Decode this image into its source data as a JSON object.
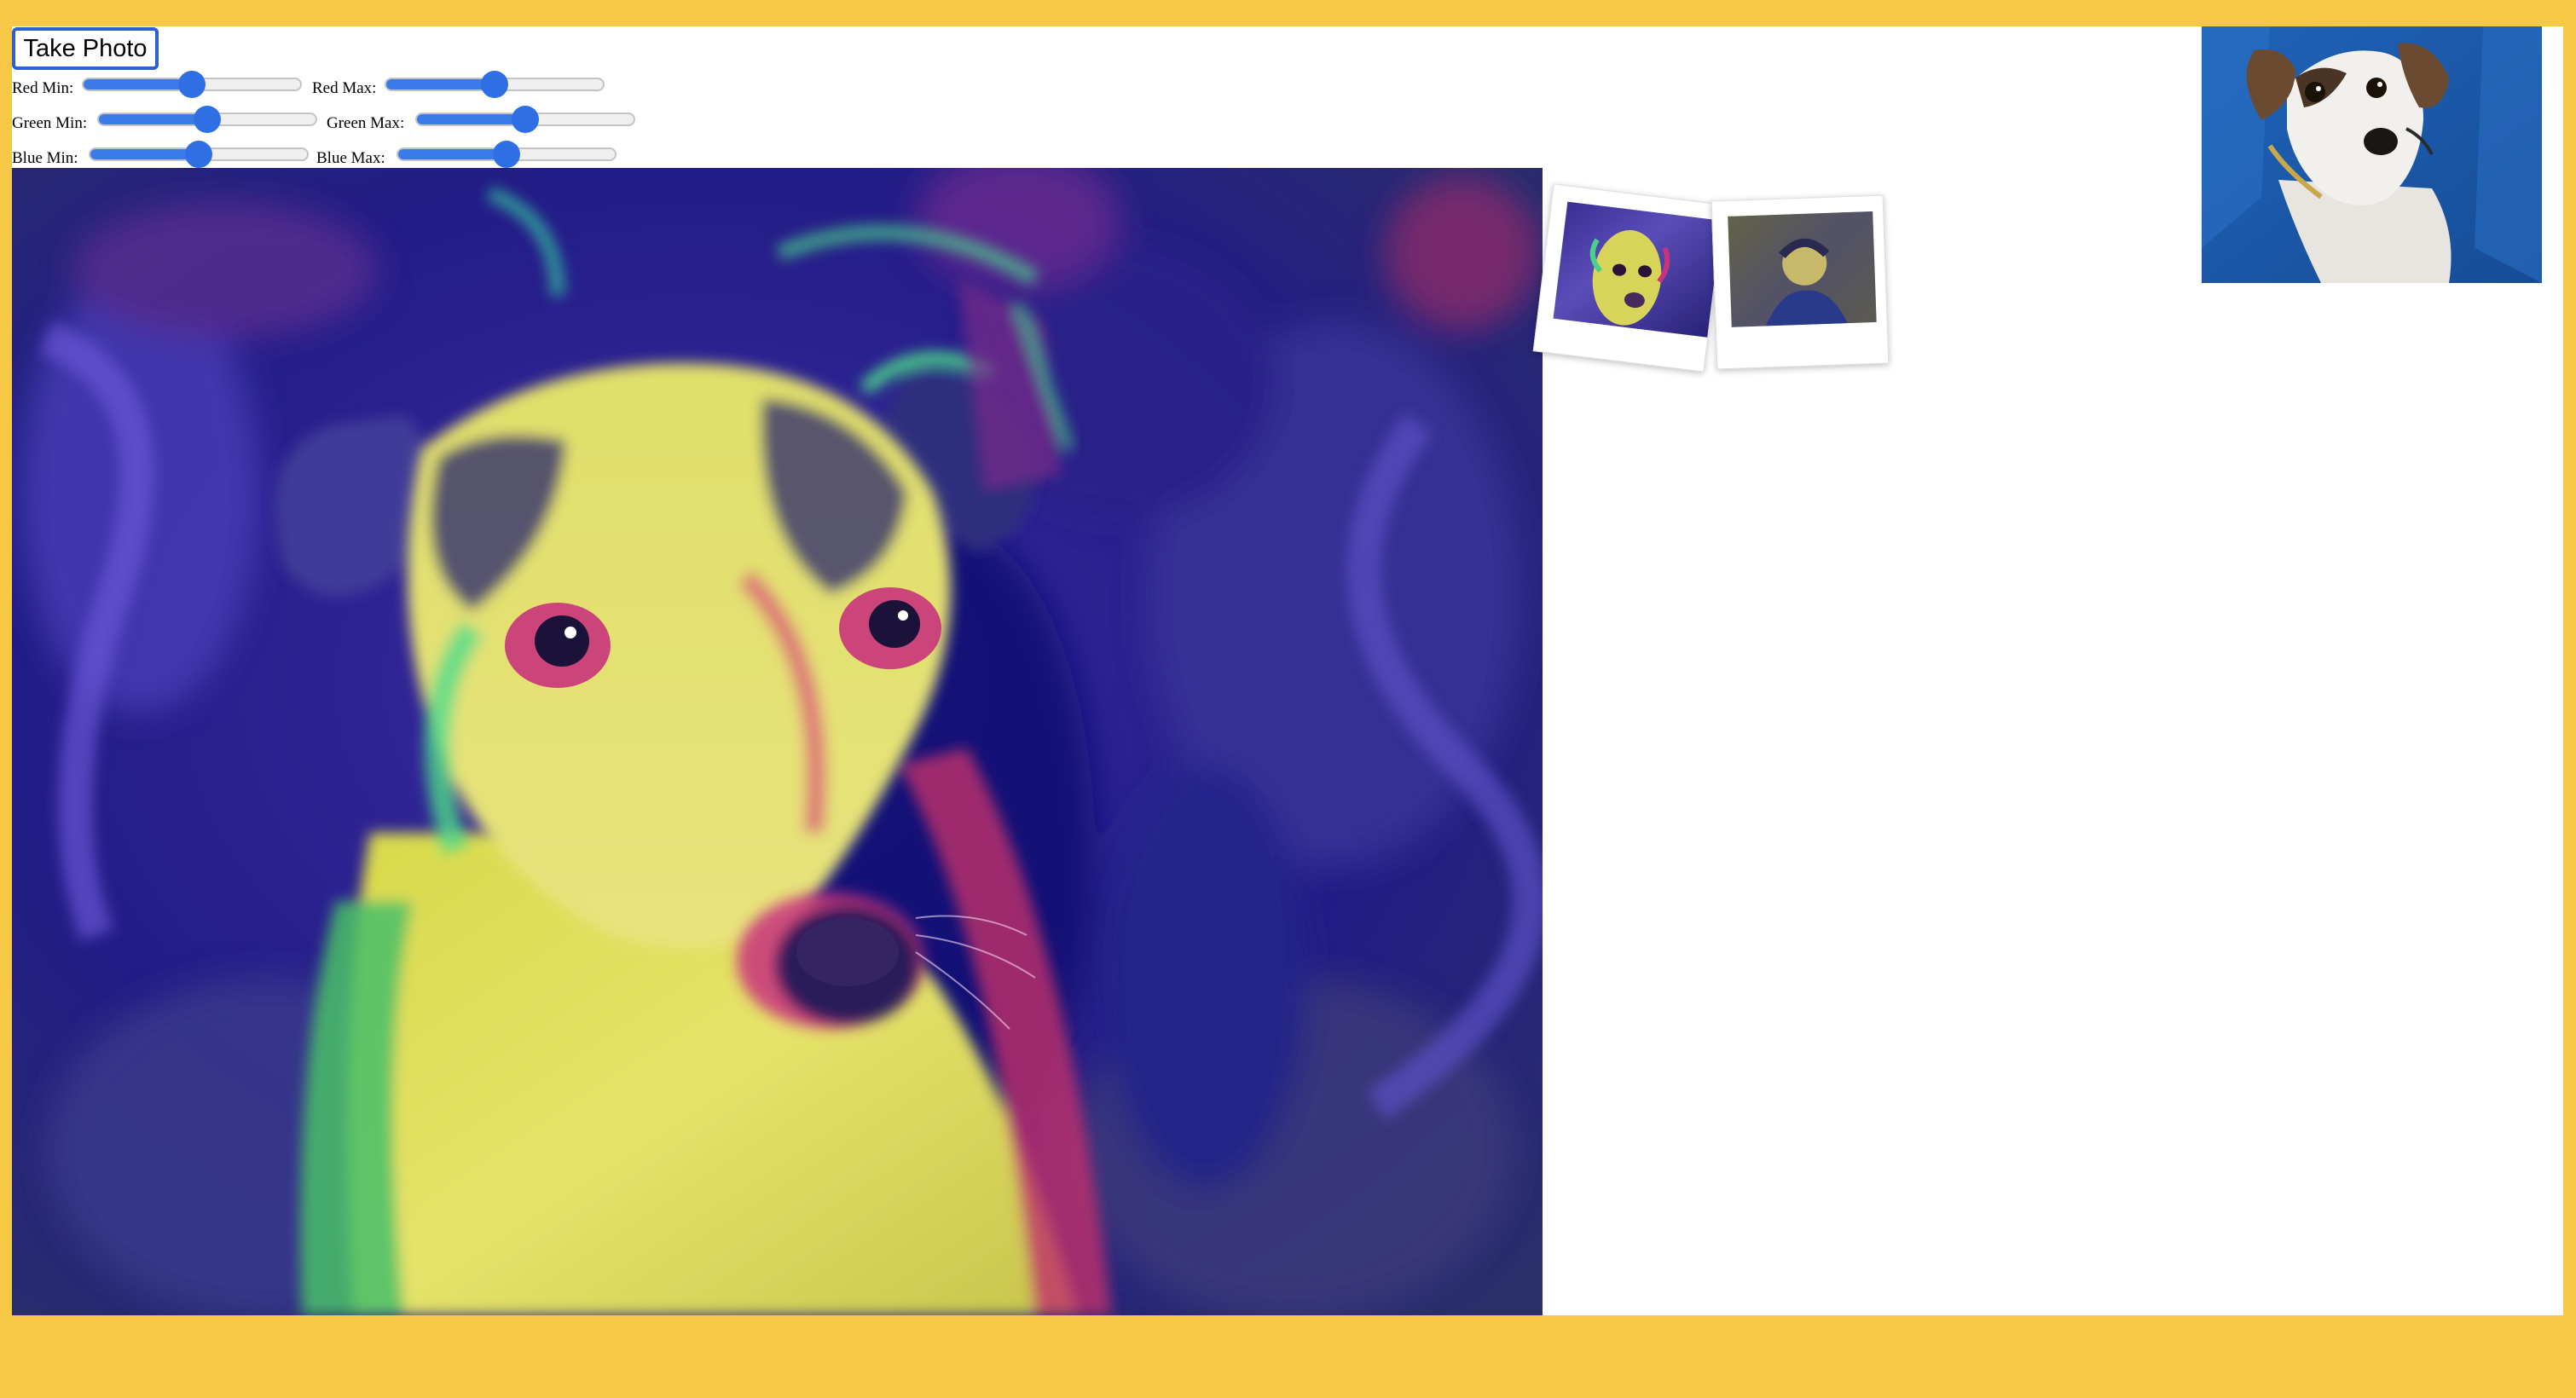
{
  "toolbar": {
    "take_photo_label": "Take Photo"
  },
  "controls": [
    {
      "label": "Red Min:",
      "value": 0.5
    },
    {
      "label": "Red Max:",
      "value": 0.5
    },
    {
      "label": "Green Min:",
      "value": 0.5
    },
    {
      "label": "Green Max:",
      "value": 0.5
    },
    {
      "label": "Blue Min:",
      "value": 0.5
    },
    {
      "label": "Blue Max:",
      "value": 0.5
    }
  ],
  "colors": {
    "page_background": "#f7c846",
    "slider_accent": "#2f6fe4",
    "button_border": "#2b60d6"
  },
  "images": {
    "main_canvas": "processed-dog-photo",
    "gallery": [
      "dog-photo-thumbnail",
      "person-photo-thumbnail"
    ],
    "webcam_preview": "dog-webcam-preview"
  }
}
